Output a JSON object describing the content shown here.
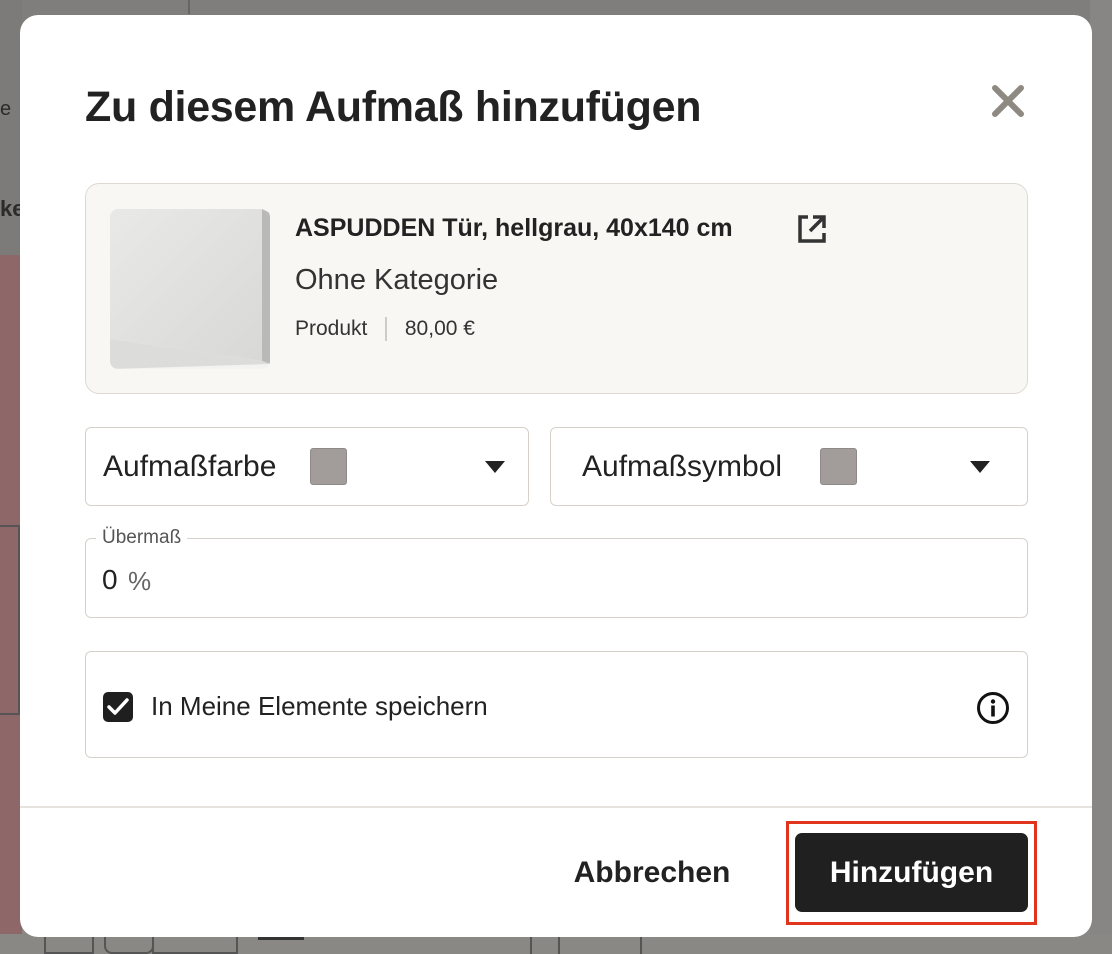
{
  "modal": {
    "title": "Zu diesem Aufmaß hinzufügen",
    "close_icon": "close-icon"
  },
  "product": {
    "name": "ASPUDDEN Tür, hellgrau, 40x140 cm",
    "category": "Ohne Kategorie",
    "type": "Produkt",
    "price": "80,00 €",
    "link_icon": "external-link-icon"
  },
  "selects": {
    "color_label": "Aufmaßfarbe",
    "color_swatch": "#a29c9a",
    "symbol_label": "Aufmaßsymbol",
    "symbol_swatch": "#a29c9a"
  },
  "oversize": {
    "label": "Übermaß",
    "value": "0",
    "unit": "%"
  },
  "save_option": {
    "label": "In Meine Elemente speichern",
    "checked": true,
    "info_icon": "info-icon"
  },
  "footer": {
    "cancel_label": "Abbrechen",
    "submit_label": "Hinzufügen",
    "highlight_color": "#e0341d"
  },
  "background": {
    "text_fragment_1": "e",
    "text_fragment_2": "ke"
  }
}
